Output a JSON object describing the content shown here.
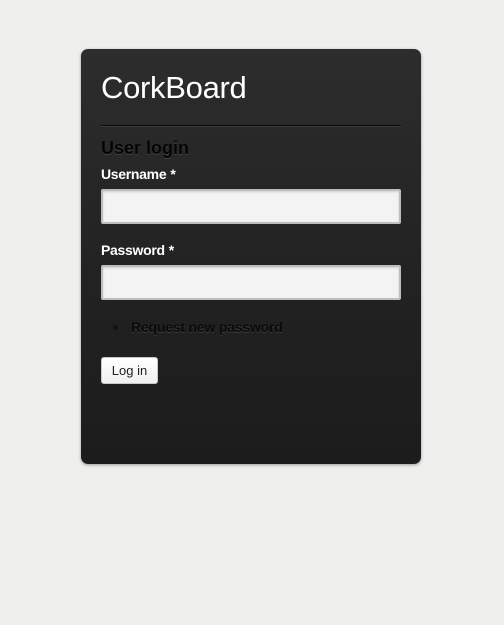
{
  "site": {
    "title": "CorkBoard"
  },
  "login_form": {
    "heading": "User login",
    "username": {
      "label": "Username",
      "required_marker": "*",
      "value": "",
      "placeholder": ""
    },
    "password": {
      "label": "Password",
      "required_marker": "*",
      "value": "",
      "placeholder": ""
    },
    "links": [
      {
        "label": "Request new password"
      }
    ],
    "submit_label": "Log in"
  },
  "colors": {
    "page_background": "#efefed",
    "card_background": "#262626",
    "heading_text": "#050505",
    "label_text": "#ffffff",
    "input_background": "#f3f3f3"
  }
}
